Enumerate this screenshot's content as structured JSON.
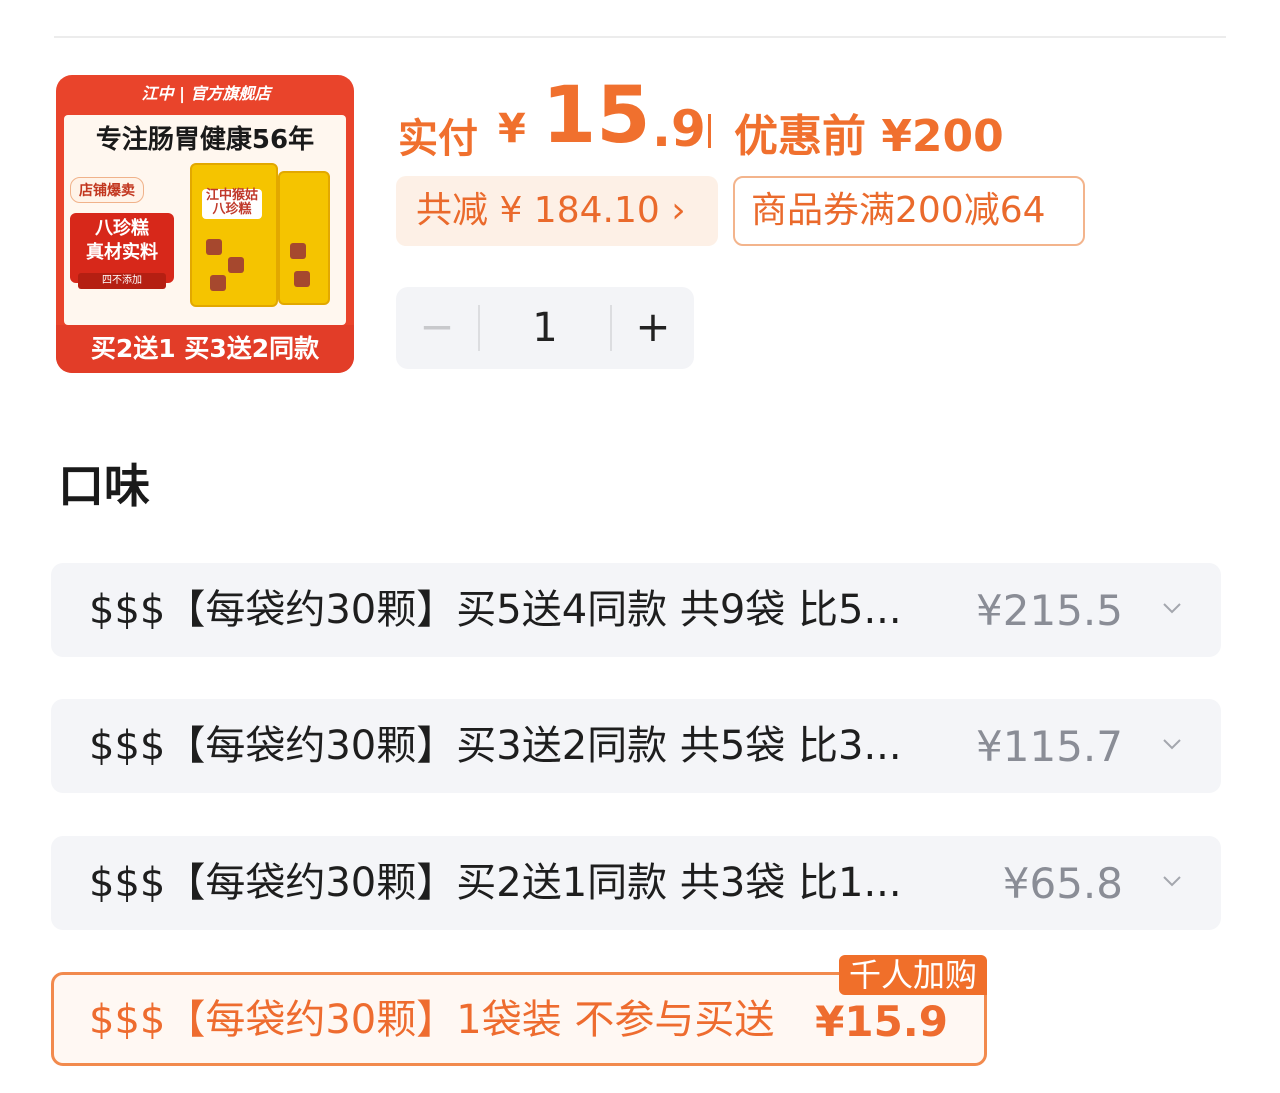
{
  "product_image": {
    "brand": "江中 | 官方旗舰店",
    "headline": "专注肠胃健康56年",
    "shop_tag": "店铺爆卖",
    "red_box_line1": "八珍糕",
    "red_box_line2": "真材实料",
    "sub_tag": "四不添加",
    "bag_label": "江中猴姑八珍糕",
    "promo": "买2送1 买3送2同款"
  },
  "price": {
    "pay_label": "实付",
    "pay_yen": "¥",
    "pay_int": "15",
    "pay_dec": ".9",
    "orig_label": "优惠前 ¥200"
  },
  "discount": {
    "label": "共减 ¥ 184.10 ›"
  },
  "coupon": {
    "label": "商品券满200减64"
  },
  "stepper": {
    "minus": "−",
    "qty": "1",
    "plus": "+"
  },
  "section_title": "口味",
  "options": [
    {
      "text": "$$$【每袋约30颗】买5送4同款 共9袋 比5...",
      "price": "¥215.5"
    },
    {
      "text": "$$$【每袋约30颗】买3送2同款 共5袋 比3...",
      "price": "¥115.7"
    },
    {
      "text": "$$$【每袋约30颗】买2送1同款 共3袋 比1...",
      "price": "¥65.8"
    }
  ],
  "selected_option": {
    "text": "$$$【每袋约30颗】1袋装 不参与买送",
    "price": "¥15.9",
    "badge": "千人加购"
  },
  "colors": {
    "accent": "#f0702e",
    "chip_bg": "#fdf0e6",
    "option_bg": "#f4f5f8"
  }
}
